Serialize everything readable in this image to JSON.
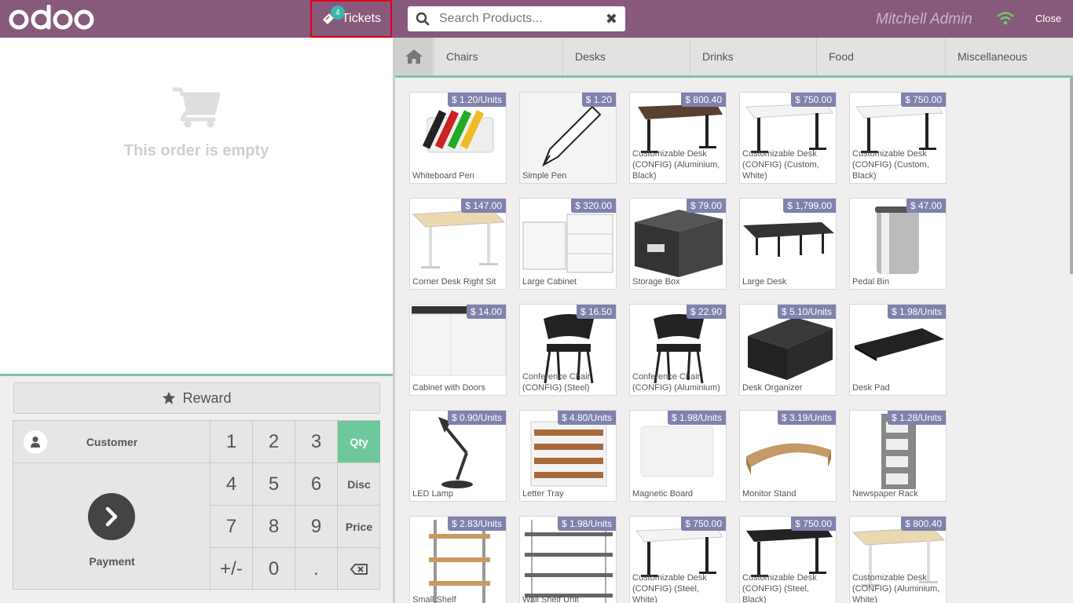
{
  "header": {
    "tickets_label": "Tickets",
    "tickets_count": "4",
    "search_placeholder": "Search Products...",
    "username": "Mitchell Admin",
    "close_label": "Close"
  },
  "order": {
    "empty_text": "This order is empty"
  },
  "controls": {
    "reward_label": "Reward",
    "customer_label": "Customer",
    "payment_label": "Payment",
    "keys": [
      "1",
      "2",
      "3",
      "4",
      "5",
      "6",
      "7",
      "8",
      "9",
      "+/-",
      "0",
      "."
    ],
    "modes": [
      "Qty",
      "Disc",
      "Price"
    ],
    "active_mode": "Qty"
  },
  "categories": [
    "Chairs",
    "Desks",
    "Drinks",
    "Food",
    "Miscellaneous"
  ],
  "products": [
    {
      "name": "Whiteboard Pen",
      "price": "$ 1.20/Units",
      "icon": "markers"
    },
    {
      "name": "Simple Pen",
      "price": "$ 1.20",
      "icon": "pen"
    },
    {
      "name": "Customizable Desk (CONFIG) (Aluminium, Black)",
      "price": "$ 800.40",
      "icon": "desk-brown"
    },
    {
      "name": "Customizable Desk (CONFIG) (Custom, White)",
      "price": "$ 750.00",
      "icon": "desk-white"
    },
    {
      "name": "Customizable Desk (CONFIG) (Custom, Black)",
      "price": "$ 750.00",
      "icon": "desk-white"
    },
    {
      "name": "Corner Desk Right Sit",
      "price": "$ 147.00",
      "icon": "desk-maple"
    },
    {
      "name": "Large Cabinet",
      "price": "$ 320.00",
      "icon": "cabinet-white"
    },
    {
      "name": "Storage Box",
      "price": "$ 79.00",
      "icon": "storage-box"
    },
    {
      "name": "Large Desk",
      "price": "$ 1,799.00",
      "icon": "desk-large"
    },
    {
      "name": "Pedal Bin",
      "price": "$ 47.00",
      "icon": "bin"
    },
    {
      "name": "Cabinet with Doors",
      "price": "$ 14.00",
      "icon": "cabinet-doors"
    },
    {
      "name": "Conference Chair (CONFIG) (Steel)",
      "price": "$ 16.50",
      "icon": "chair"
    },
    {
      "name": "Conference Chair (CONFIG) (Aluminium)",
      "price": "$ 22.90",
      "icon": "chair"
    },
    {
      "name": "Desk Organizer",
      "price": "$ 5.10/Units",
      "icon": "organizer"
    },
    {
      "name": "Desk Pad",
      "price": "$ 1.98/Units",
      "icon": "desk-pad"
    },
    {
      "name": "LED Lamp",
      "price": "$ 0.90/Units",
      "icon": "lamp"
    },
    {
      "name": "Letter Tray",
      "price": "$ 4.80/Units",
      "icon": "letter-tray"
    },
    {
      "name": "Magnetic Board",
      "price": "$ 1.98/Units",
      "icon": "board"
    },
    {
      "name": "Monitor Stand",
      "price": "$ 3.19/Units",
      "icon": "monitor-stand"
    },
    {
      "name": "Newspaper Rack",
      "price": "$ 1.28/Units",
      "icon": "rack"
    },
    {
      "name": "Small Shelf",
      "price": "$ 2.83/Units",
      "icon": "shelf"
    },
    {
      "name": "Wall Shelf Unit",
      "price": "$ 1.98/Units",
      "icon": "wall-shelf"
    },
    {
      "name": "Customizable Desk (CONFIG) (Steel, White)",
      "price": "$ 750.00",
      "icon": "desk-white"
    },
    {
      "name": "Customizable Desk (CONFIG) (Steel, Black)",
      "price": "$ 750.00",
      "icon": "desk-black"
    },
    {
      "name": "Customizable Desk (CONFIG) (Aluminium, White)",
      "price": "$ 800.40",
      "icon": "desk-maple"
    }
  ],
  "colors": {
    "topbar": "#875a7b",
    "accent_green": "#6ec89b",
    "price_tag": "#7f82ac",
    "tickets_badge": "#40b3b0"
  }
}
